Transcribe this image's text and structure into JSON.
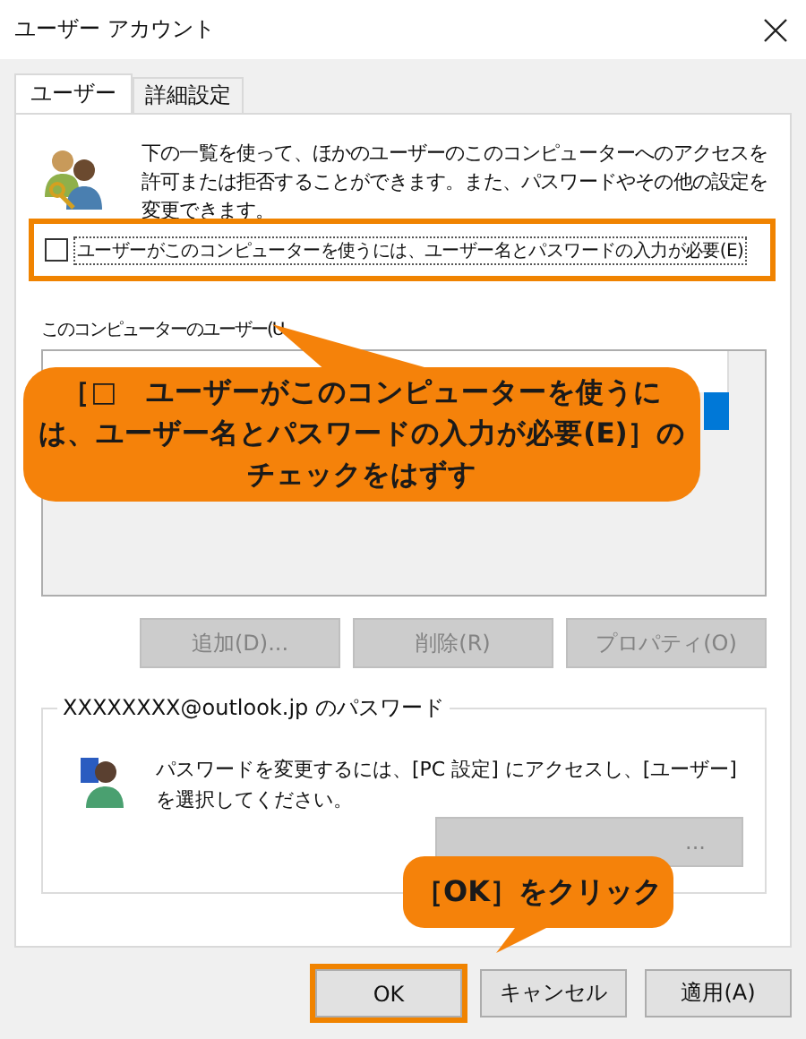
{
  "window": {
    "title": "ユーザー アカウント"
  },
  "tabs": [
    {
      "label": "ユーザー",
      "selected": true
    },
    {
      "label": "詳細設定",
      "selected": false
    }
  ],
  "description": "下の一覧を使って、ほかのユーザーのこのコンピューターへのアクセスを許可または拒否することができます。また、パスワードやその他の設定を変更できます。",
  "require_password": {
    "label": "ユーザーがこのコンピューターを使うには、ユーザー名とパスワードの入力が必要(E)",
    "checked": false,
    "highlighted": true
  },
  "users_list": {
    "label": "このコンピューターのユーザー(U"
  },
  "list_buttons": [
    {
      "label": "追加(D)...",
      "disabled": true
    },
    {
      "label": "削除(R)",
      "disabled": true
    },
    {
      "label": "プロパティ(O)",
      "disabled": true
    }
  ],
  "password_group": {
    "title": "XXXXXXXX@outlook.jp のパスワード",
    "text": "パスワードを変更するには、[PC 設定] にアクセスし、[ユーザー] を選択してください。",
    "button_label": "..."
  },
  "dialog_buttons": [
    {
      "label": "OK",
      "highlighted": true,
      "disabled": false
    },
    {
      "label": "キャンセル",
      "highlighted": false,
      "disabled": false
    },
    {
      "label": "適用(A)",
      "highlighted": false,
      "disabled": false
    }
  ],
  "callouts": [
    {
      "text": "［□　ユーザーがこのコンピューターを使うには、ユーザー名とパスワードの入力が必要(E)］のチェックをはずす",
      "kind": "top"
    },
    {
      "text": "［OK］をクリック",
      "kind": "bottom"
    }
  ]
}
